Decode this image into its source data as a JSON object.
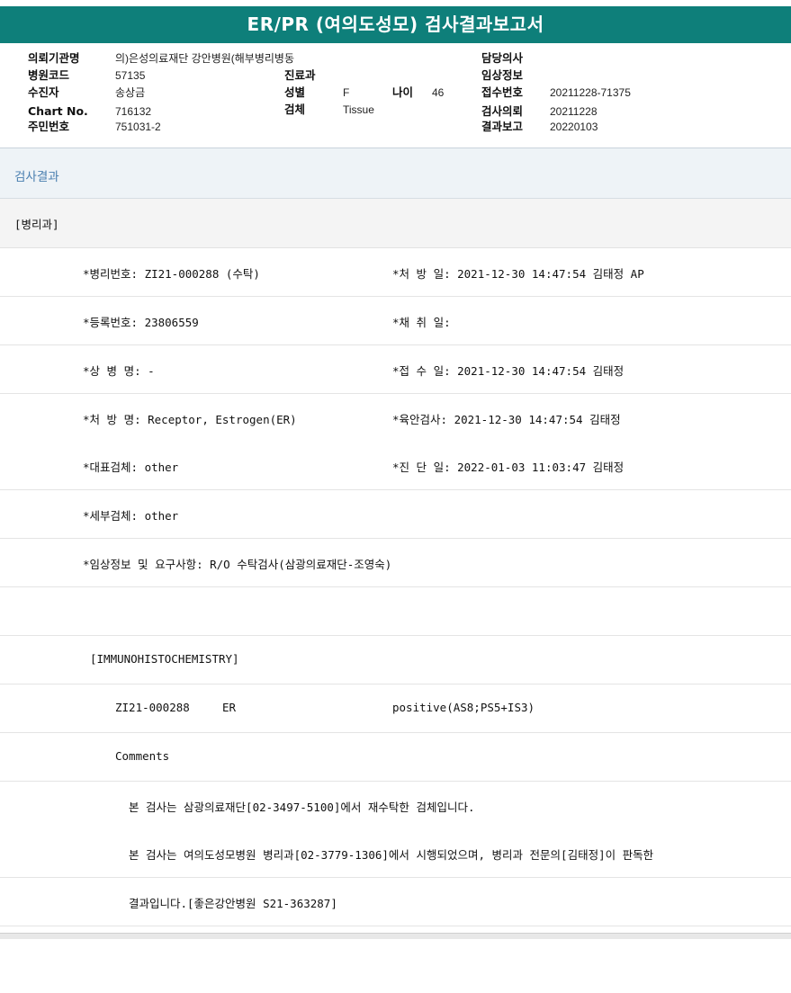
{
  "title": "ER/PR (여의도성모) 검사결과보고서",
  "header": {
    "institution_label": "의뢰기관명",
    "institution_value": "의)은성의료재단 강안병원(해부병리병동",
    "hospital_code_label": "병원코드",
    "hospital_code_value": "57135",
    "patient_label": "수진자",
    "patient_value": "송상금",
    "chart_label": "Chart No.",
    "chart_value": "716132",
    "resident_label": "주민번호",
    "resident_value": "751031-2",
    "dept_label": "진료과",
    "dept_value": "",
    "sex_label": "성별",
    "sex_value": "F",
    "age_label": "나이",
    "age_value": "46",
    "specimen_label": "검체",
    "specimen_value": "Tissue",
    "doctor_label": "담당의사",
    "doctor_value": "",
    "clinical_label": "임상정보",
    "clinical_value": "",
    "receipt_label": "접수번호",
    "receipt_value": "20211228-71375",
    "request_label": "검사의뢰",
    "request_value": "20211228",
    "report_label": "결과보고",
    "report_value": "20220103"
  },
  "section_title": "검사결과",
  "department": "[병리과]",
  "rows": [
    {
      "left": "*병리번호: ZI21-000288 (수탁)",
      "right": "*처 방 일: 2021-12-30 14:47:54  김태정 AP"
    },
    {
      "left": "*등록번호: 23806559",
      "right": "*채 취 일:"
    },
    {
      "left": "*상 병 명: -",
      "right": "*접 수 일: 2021-12-30 14:47:54  김태정"
    },
    {
      "left": "*처 방 명: Receptor, Estrogen(ER)",
      "right": "*육안검사: 2021-12-30 14:47:54  김태정"
    },
    {
      "left": "*대표검체: other",
      "right": "*진 단 일: 2022-01-03 11:03:47  김태정"
    },
    {
      "left": "*세부검체: other",
      "right": ""
    },
    {
      "left": "*임상정보 및 요구사항: R/O 수탁검사(삼광의료재단-조영숙)",
      "right": ""
    }
  ],
  "ihc": {
    "heading": "[IMMUNOHISTOCHEMISTRY]",
    "result_id": "ZI21-000288",
    "result_marker": "ER",
    "result_value": "positive(AS8;PS5+IS3)",
    "comments_label": "Comments",
    "comment_lines": [
      "본 검사는 삼광의료재단[02-3497-5100]에서 재수탁한 검체입니다.",
      "본 검사는 여의도성모병원 병리과[02-3779-1306]에서 시행되었으며, 병리과 전문의[김태정]이 판독한",
      "결과입니다.[좋은강안병원 S21-363287]"
    ]
  }
}
